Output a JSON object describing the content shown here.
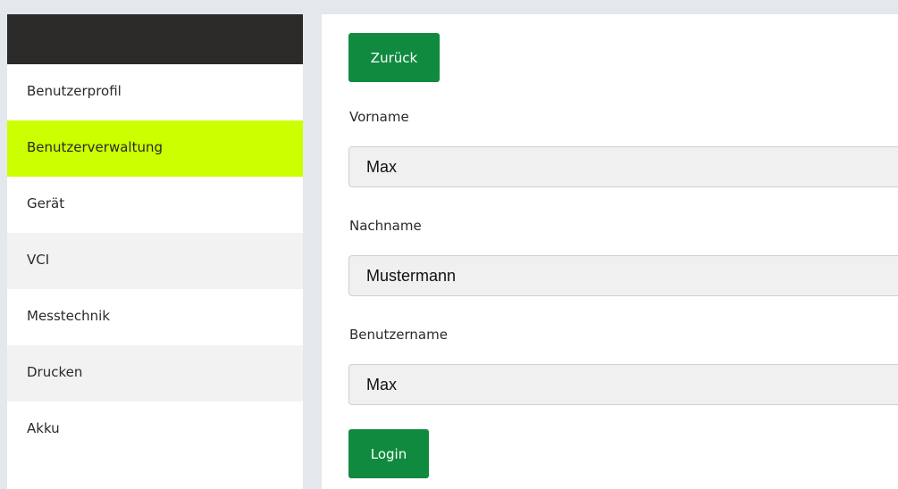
{
  "sidebar": {
    "items": [
      {
        "label": "Benutzerprofil"
      },
      {
        "label": "Benutzerverwaltung"
      },
      {
        "label": "Gerät"
      },
      {
        "label": "VCI"
      },
      {
        "label": "Messtechnik"
      },
      {
        "label": "Drucken"
      },
      {
        "label": "Akku"
      }
    ],
    "active_index": 1
  },
  "main": {
    "back_label": "Zurück",
    "login_label": "Login",
    "fields": {
      "vorname": {
        "label": "Vorname",
        "value": "Max"
      },
      "nachname": {
        "label": "Nachname",
        "value": "Mustermann"
      },
      "benutzername": {
        "label": "Benutzername",
        "value": "Max"
      }
    }
  },
  "colors": {
    "accent_green": "#108a3f",
    "active_highlight": "#ccff00",
    "sidebar_header": "#2b2a29",
    "page_background": "#e3e8ec"
  }
}
